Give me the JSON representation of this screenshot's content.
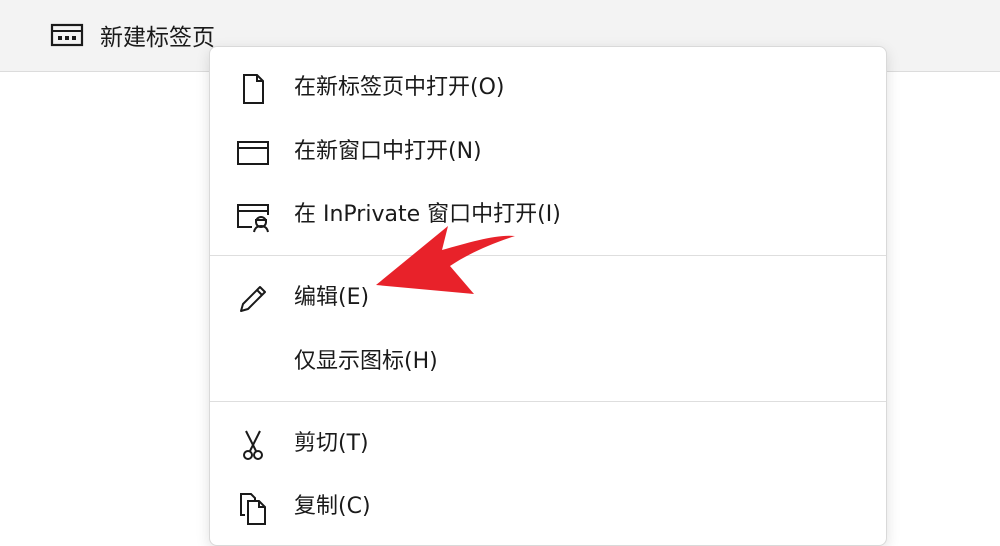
{
  "topbar": {
    "tab_label": "新建标签页",
    "tab_icon": "new-tab-icon"
  },
  "menu": {
    "open_new_tab": "在新标签页中打开(O)",
    "open_new_window": "在新窗口中打开(N)",
    "open_inprivate": "在 InPrivate 窗口中打开(I)",
    "edit": "编辑(E)",
    "show_icon_only": "仅显示图标(H)",
    "cut": "剪切(T)",
    "copy": "复制(C)"
  },
  "colors": {
    "arrow": "#e8222a",
    "menu_bg": "#ffffff",
    "bar_bg": "#f3f3f3"
  }
}
